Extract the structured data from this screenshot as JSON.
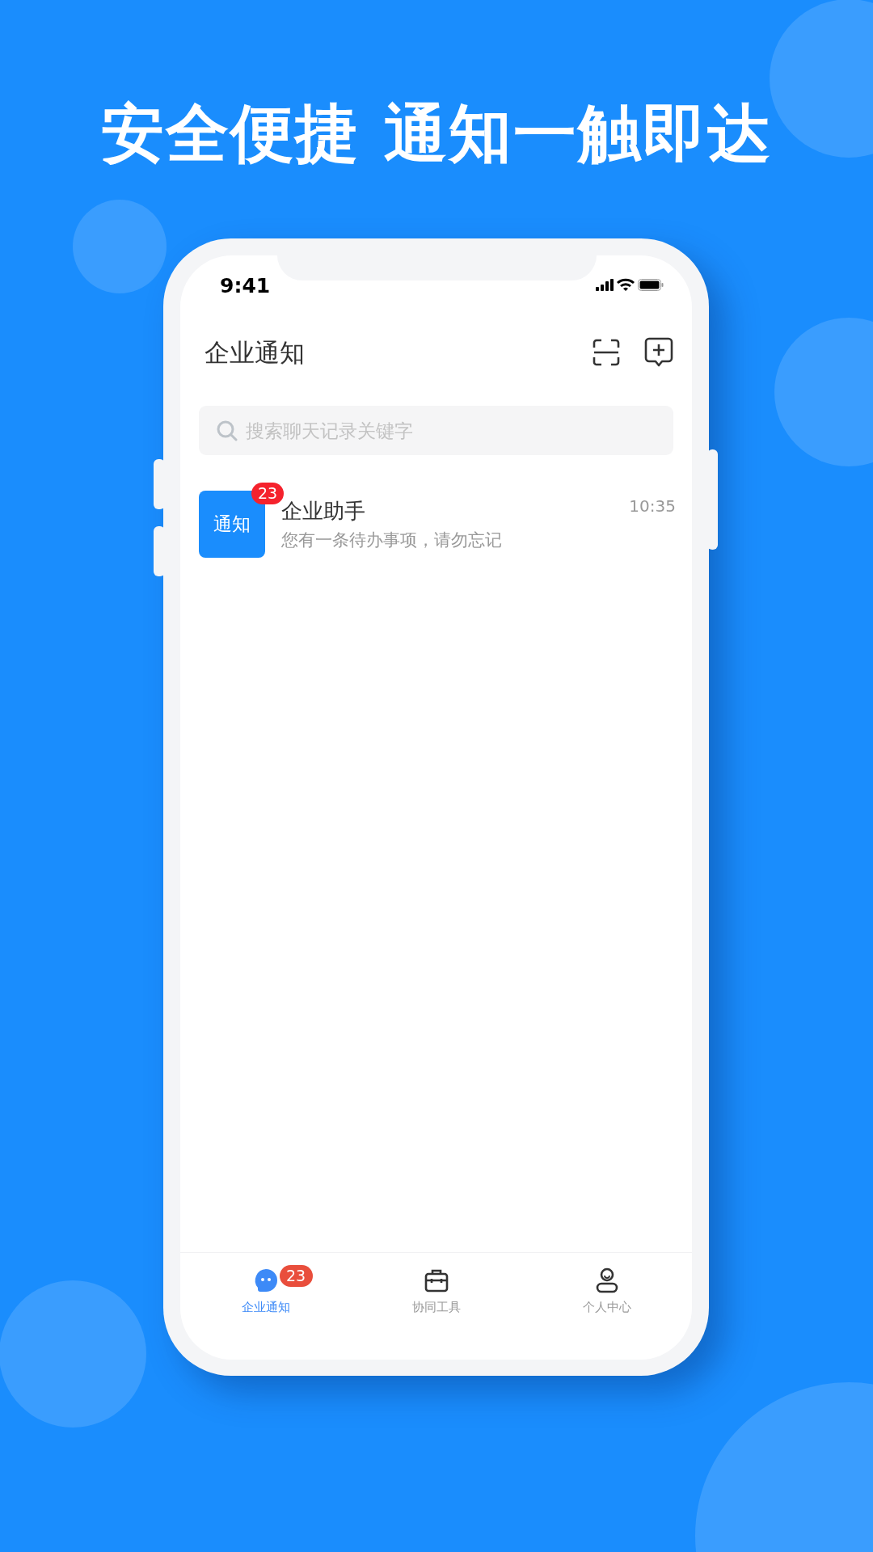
{
  "headline": "安全便捷 通知一触即达",
  "status_bar": {
    "time": "9:41"
  },
  "header": {
    "title": "企业通知"
  },
  "search": {
    "placeholder": "搜索聊天记录关键字"
  },
  "chats": [
    {
      "avatar_text": "通知",
      "badge": "23",
      "title": "企业助手",
      "preview": "您有一条待办事项，请勿忘记",
      "time": "10:35"
    }
  ],
  "tabs": [
    {
      "kind": "chat",
      "label": "企业通知",
      "selected": true,
      "badge": "23"
    },
    {
      "kind": "tools",
      "label": "协同工具",
      "selected": false
    },
    {
      "kind": "person",
      "label": "个人中心",
      "selected": false
    }
  ]
}
